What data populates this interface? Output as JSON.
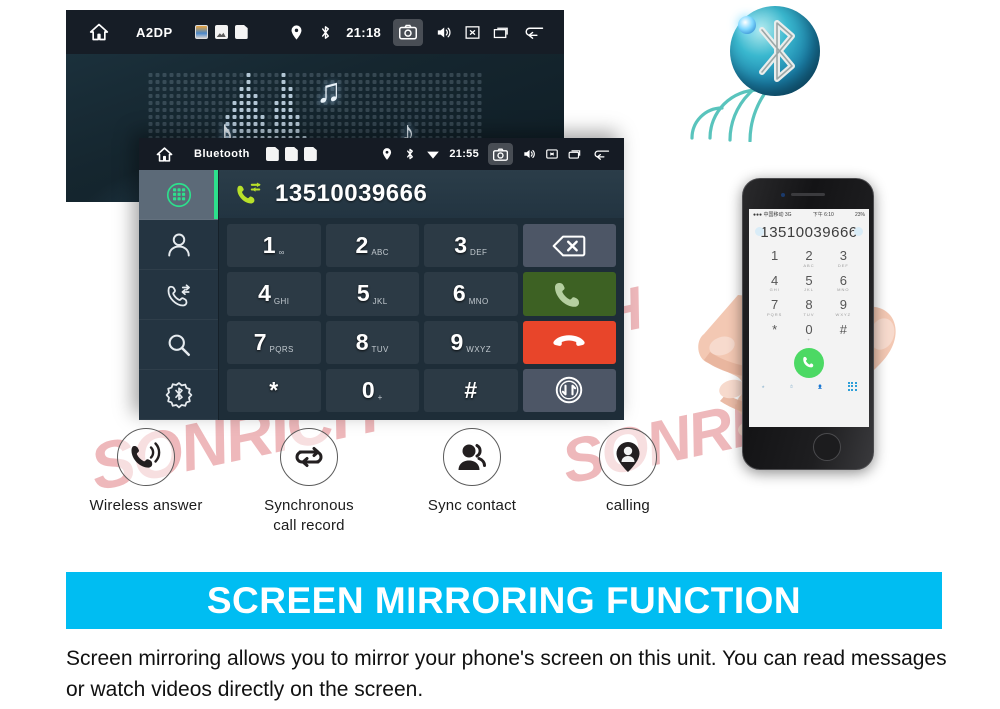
{
  "watermark": {
    "text": "SONRICH"
  },
  "head_unit_music": {
    "statusbar": {
      "home_icon": "home-icon",
      "label": "A2DP",
      "mini_icons": [
        "picture-app-icon",
        "gallery-icon",
        "sd-card-icon"
      ],
      "location_icon": "location-pin-icon",
      "bluetooth_icon": "bluetooth-icon",
      "time": "21:18",
      "camera_icon": "camera-icon",
      "volume_icon": "volume-icon",
      "close_icon": "close-box-icon",
      "recents_icon": "recents-icon",
      "back_icon": "back-arrow-icon"
    },
    "visualizer": {
      "notes": [
        "♪",
        "♫",
        "♪"
      ]
    }
  },
  "head_unit_dialer": {
    "statusbar": {
      "home_icon": "home-icon",
      "label": "Bluetooth",
      "mini_icons": [
        "sd-card-icon",
        "sd-card-icon",
        "sd-card-icon"
      ],
      "location_icon": "location-pin-icon",
      "bluetooth_icon": "bluetooth-icon",
      "wifi_icon": "wifi-icon",
      "time": "21:55",
      "camera_icon": "camera-icon",
      "volume_icon": "volume-icon",
      "close_icon": "close-box-icon",
      "recents_icon": "recents-icon",
      "back_icon": "back-arrow-icon"
    },
    "sidebar": [
      {
        "name": "keypad",
        "icon": "keypad-icon",
        "active": true
      },
      {
        "name": "contacts",
        "icon": "contact-person-icon",
        "active": false
      },
      {
        "name": "call-history",
        "icon": "call-history-icon",
        "active": false
      },
      {
        "name": "search",
        "icon": "search-icon",
        "active": false
      },
      {
        "name": "bluetooth-settings",
        "icon": "bluetooth-gear-icon",
        "active": false
      }
    ],
    "number_bar": {
      "call_icon": "outgoing-call-icon",
      "number": "13510039666"
    },
    "keys": [
      {
        "digit": "1",
        "letters": "∞",
        "type": "digit"
      },
      {
        "digit": "2",
        "letters": "ABC",
        "type": "digit"
      },
      {
        "digit": "3",
        "letters": "DEF",
        "type": "digit"
      },
      {
        "digit": "",
        "letters": "",
        "type": "backspace",
        "icon": "backspace-icon"
      },
      {
        "digit": "4",
        "letters": "GHI",
        "type": "digit"
      },
      {
        "digit": "5",
        "letters": "JKL",
        "type": "digit"
      },
      {
        "digit": "6",
        "letters": "MNO",
        "type": "digit"
      },
      {
        "digit": "",
        "letters": "",
        "type": "call",
        "icon": "call-answer-icon"
      },
      {
        "digit": "7",
        "letters": "PQRS",
        "type": "digit"
      },
      {
        "digit": "8",
        "letters": "TUV",
        "type": "digit"
      },
      {
        "digit": "9",
        "letters": "WXYZ",
        "type": "digit"
      },
      {
        "digit": "",
        "letters": "",
        "type": "hangup",
        "icon": "call-end-icon"
      },
      {
        "digit": "*",
        "letters": "",
        "type": "digit"
      },
      {
        "digit": "0",
        "letters": "+",
        "type": "digit"
      },
      {
        "digit": "#",
        "letters": "",
        "type": "digit"
      },
      {
        "digit": "",
        "letters": "",
        "type": "transfer",
        "icon": "audio-transfer-icon"
      }
    ]
  },
  "bluetooth_logo": {
    "icon": "bluetooth-sphere-logo",
    "waves": 4
  },
  "features": [
    {
      "icon": "wireless-answer-icon",
      "label": "Wireless answer"
    },
    {
      "icon": "sync-loop-icon",
      "label": "Synchronous\ncall record"
    },
    {
      "icon": "sync-contact-icon",
      "label": "Sync contact"
    },
    {
      "icon": "calling-pin-icon",
      "label": "calling"
    }
  ],
  "phone": {
    "status": {
      "left": "●●● 中国移动 3G",
      "center": "下午 6:10",
      "right": "23%"
    },
    "number": "13510039666",
    "keys": [
      {
        "d": "1",
        "s": ""
      },
      {
        "d": "2",
        "s": "ABC"
      },
      {
        "d": "3",
        "s": "DEF"
      },
      {
        "d": "4",
        "s": "GHI"
      },
      {
        "d": "5",
        "s": "JKL"
      },
      {
        "d": "6",
        "s": "MNO"
      },
      {
        "d": "7",
        "s": "PQRS"
      },
      {
        "d": "8",
        "s": "TUV"
      },
      {
        "d": "9",
        "s": "WXYZ"
      },
      {
        "d": "*",
        "s": ""
      },
      {
        "d": "0",
        "s": "+"
      },
      {
        "d": "#",
        "s": ""
      }
    ],
    "call_icon": "call-answer-icon",
    "keypad_tab_label": "键盘"
  },
  "banner": {
    "title": "SCREEN MIRRORING FUNCTION",
    "color": "#00bdf2"
  },
  "description": {
    "text": "Screen mirroring allows you to mirror your phone's screen on this unit. You can read messages or watch videos directly on the screen."
  }
}
